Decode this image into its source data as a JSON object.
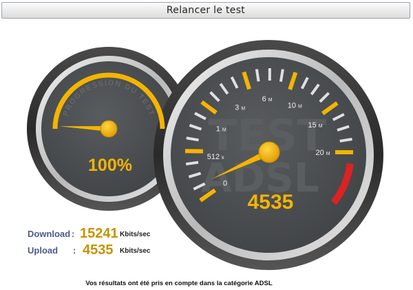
{
  "retest_button": {
    "label": "Relancer le test"
  },
  "progress_gauge": {
    "arc_label": "PROGRESSION DU TEST",
    "value_text": "100%",
    "progress": 1.0
  },
  "speed_gauge": {
    "watermark_lines": [
      "TEST",
      "ADSL"
    ],
    "tick_labels": [
      {
        "text": "0",
        "unit": ""
      },
      {
        "text": "512",
        "unit": "k"
      },
      {
        "text": "1",
        "unit": "M"
      },
      {
        "text": "3",
        "unit": "M"
      },
      {
        "text": "6",
        "unit": "M"
      },
      {
        "text": "10",
        "unit": "M"
      },
      {
        "text": "15",
        "unit": "M"
      },
      {
        "text": "20",
        "unit": "M"
      }
    ],
    "value_text": "4535",
    "reading_kbits": 4535
  },
  "results": {
    "download": {
      "label": "Download",
      "colon": ":",
      "value": "15241",
      "unit": "Kbits/sec"
    },
    "upload": {
      "label": "Upload",
      "colon": ":",
      "value": "4535",
      "unit": "Kbits/sec"
    }
  },
  "footer": {
    "note": "Vos résultats ont été pris en compte dans la catégorie ADSL"
  },
  "colors": {
    "accent_gold": "#f5b400",
    "value_gold": "#c79200",
    "label_blue": "#4a5a8a",
    "redline": "#dd2222",
    "dial_face": "#4f5254"
  }
}
